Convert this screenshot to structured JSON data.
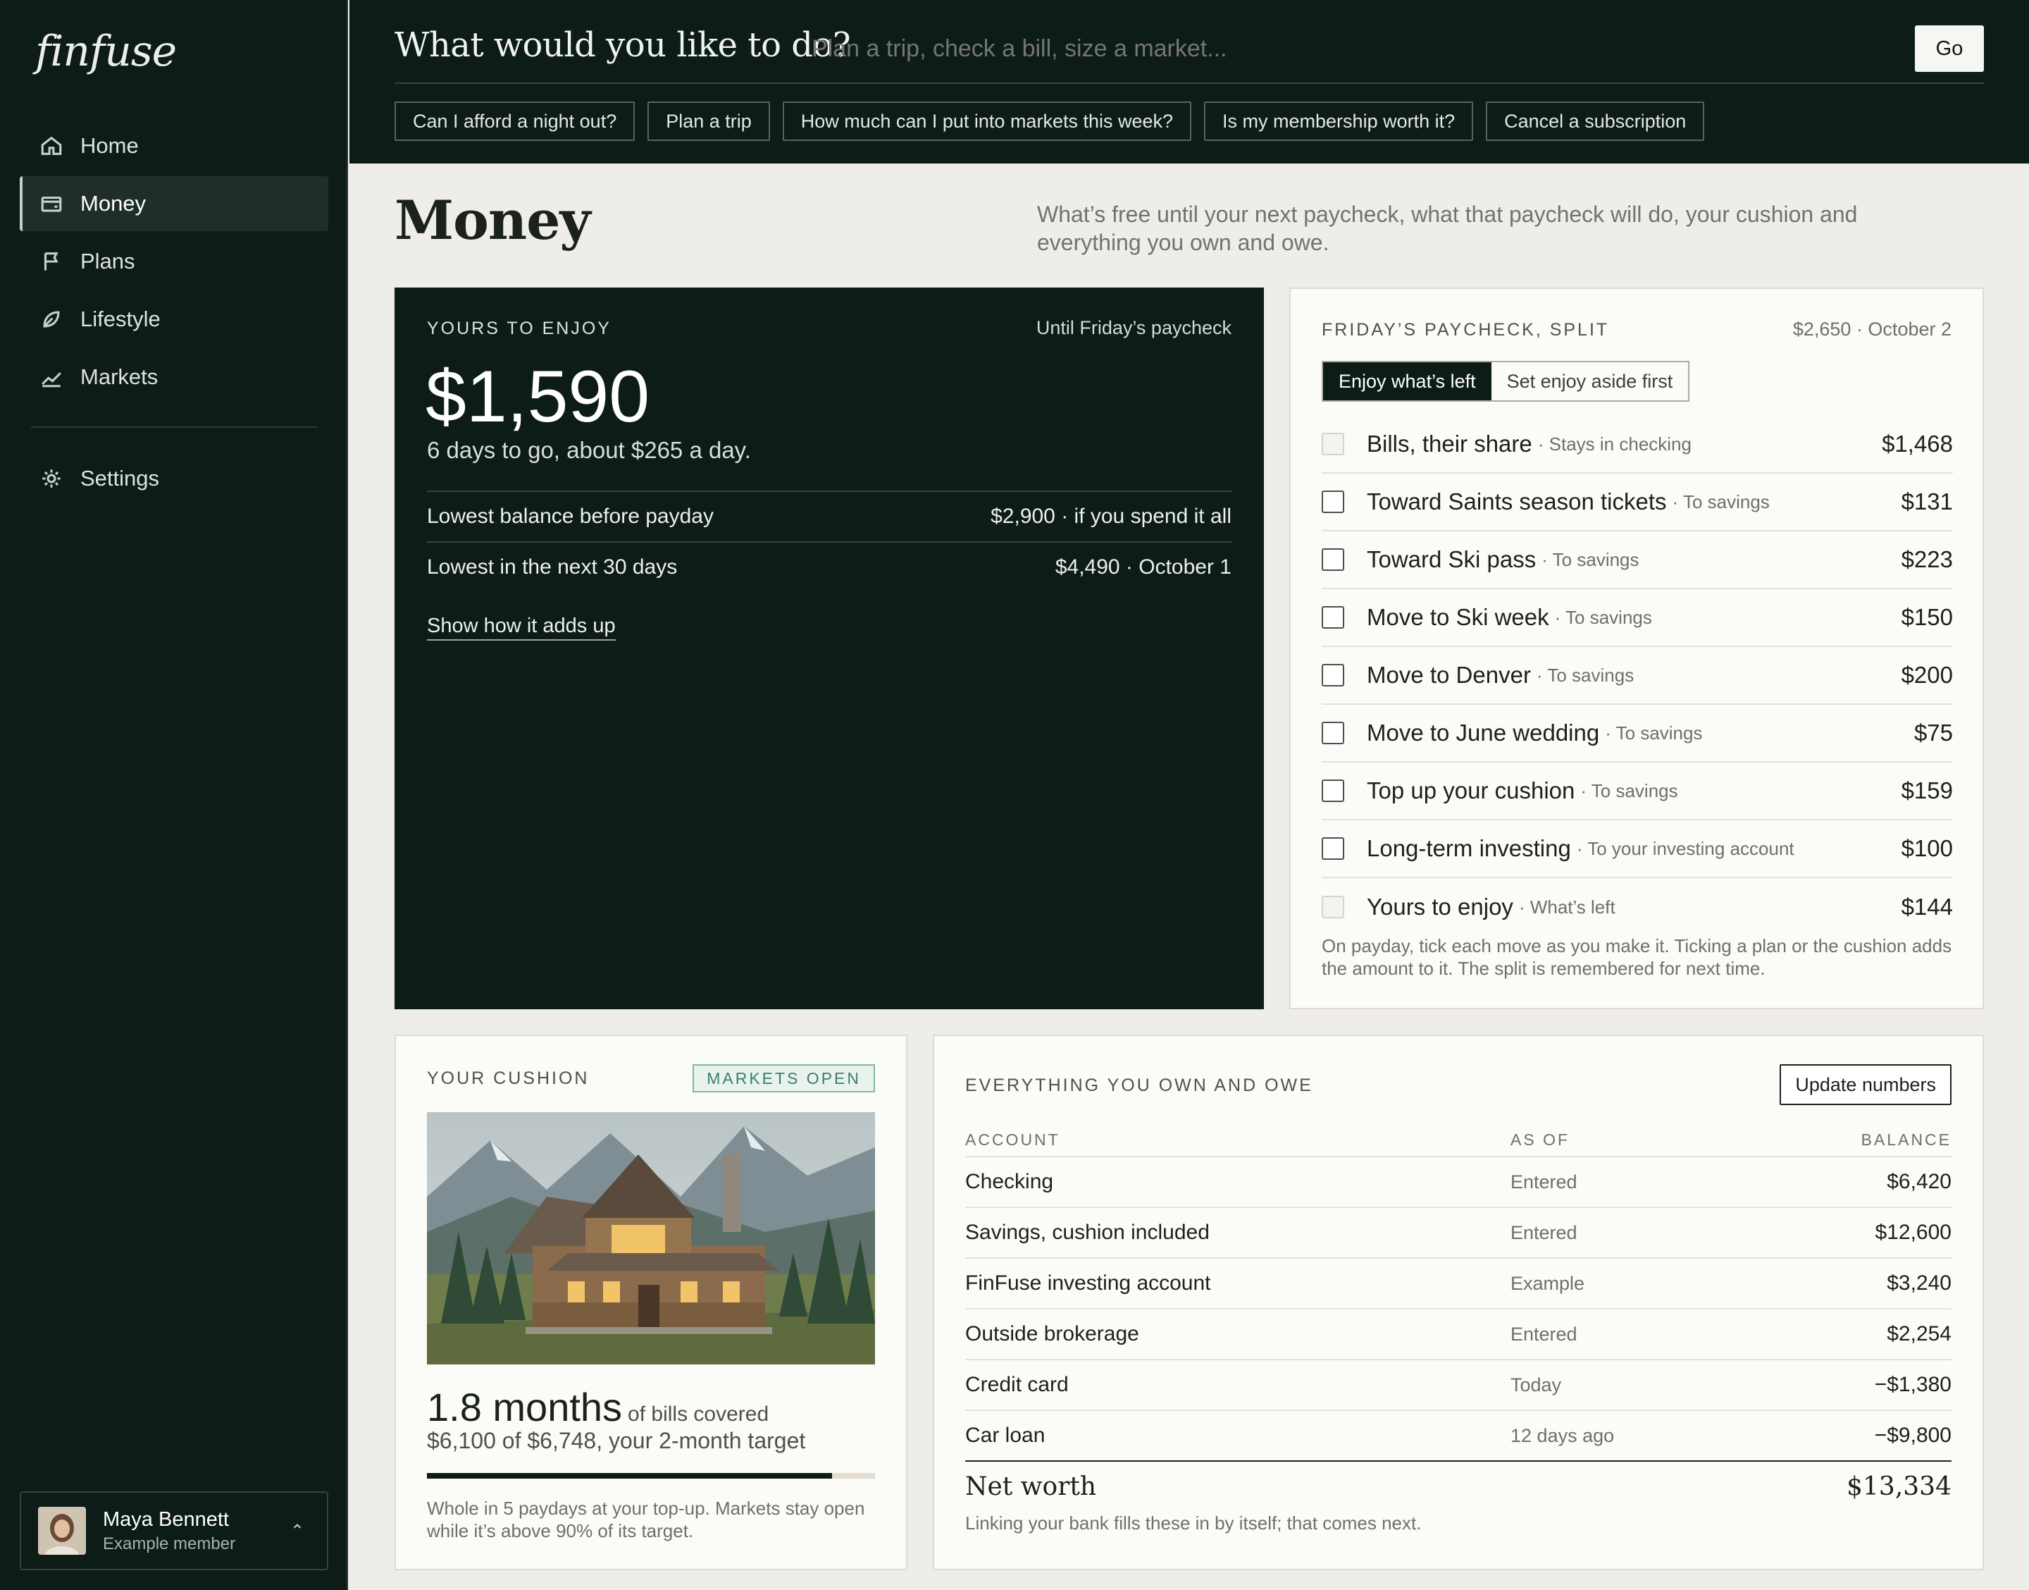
{
  "brand": {
    "logo": "finfuse"
  },
  "nav": {
    "items": [
      {
        "label": "Home",
        "icon": "home-icon"
      },
      {
        "label": "Money",
        "icon": "wallet-icon"
      },
      {
        "label": "Plans",
        "icon": "flag-icon"
      },
      {
        "label": "Lifestyle",
        "icon": "leaf-icon"
      },
      {
        "label": "Markets",
        "icon": "chart-line-icon"
      }
    ],
    "active": "Money",
    "settings": {
      "label": "Settings",
      "icon": "gear-icon"
    }
  },
  "user": {
    "name": "Maya Bennett",
    "subtitle": "Example member",
    "chevron": "⌃"
  },
  "prompt": {
    "title": "What would you like to do?",
    "placeholder": "Plan a trip, check a bill, size a market...",
    "go_label": "Go",
    "chips": [
      "Can I afford a night out?",
      "Plan a trip",
      "How much can I put into markets this week?",
      "Is my membership worth it?",
      "Cancel a subscription"
    ]
  },
  "page": {
    "title": "Money",
    "description": "What’s free until your next paycheck, what that paycheck will do, your cushion and everything you own and owe."
  },
  "enjoy": {
    "eyebrow": "Yours to enjoy",
    "until": "Until Friday’s paycheck",
    "amount": "$1,590",
    "days": "6 days to go, about $265 a day.",
    "rows": [
      {
        "label": "Lowest balance before payday",
        "value": "$2,900 · if you spend it all"
      },
      {
        "label": "Lowest in the next 30 days",
        "value": "$4,490 · October 1"
      }
    ],
    "link": "Show how it adds up"
  },
  "paycheck": {
    "eyebrow": "Friday’s paycheck, split",
    "meta": "$2,650 · October 2",
    "toggle": [
      "Enjoy what’s left",
      "Set enjoy aside first"
    ],
    "rows": [
      {
        "label": "Bills, their share",
        "sub": "· Stays in checking",
        "amount": "$1,468",
        "disabled": true
      },
      {
        "label": "Toward Saints season tickets",
        "sub": "· To savings",
        "amount": "$131"
      },
      {
        "label": "Toward Ski pass",
        "sub": "· To savings",
        "amount": "$223"
      },
      {
        "label": "Move to Ski week",
        "sub": "· To savings",
        "amount": "$150"
      },
      {
        "label": "Move to Denver",
        "sub": "· To savings",
        "amount": "$200"
      },
      {
        "label": "Move to June wedding",
        "sub": "· To savings",
        "amount": "$75"
      },
      {
        "label": "Top up your cushion",
        "sub": "· To savings",
        "amount": "$159"
      },
      {
        "label": "Long-term investing",
        "sub": "· To your investing account",
        "amount": "$100"
      },
      {
        "label": "Yours to enjoy",
        "sub": "· What’s left",
        "amount": "$144",
        "disabled": true
      }
    ],
    "note": "On payday, tick each move as you make it. Ticking a plan or the cushion adds the amount to it. The split is remembered for next time."
  },
  "cushion": {
    "eyebrow": "Your cushion",
    "badge": "MARKETS OPEN",
    "months": "1.8 months",
    "months_suffix": "of bills covered",
    "target_line": "$6,100 of $6,748, your 2-month target",
    "progress_fraction": 0.904,
    "note": "Whole in 5 paydays at your top-up. Markets stay open while it’s above 90% of its target."
  },
  "networth": {
    "eyebrow": "Everything you own and owe",
    "update_label": "Update numbers",
    "columns": [
      "ACCOUNT",
      "AS OF",
      "BALANCE"
    ],
    "rows": [
      {
        "account": "Checking",
        "asof": "Entered",
        "balance": "$6,420"
      },
      {
        "account": "Savings, cushion included",
        "asof": "Entered",
        "balance": "$12,600"
      },
      {
        "account": "FinFuse investing account",
        "asof": "Example",
        "balance": "$3,240"
      },
      {
        "account": "Outside brokerage",
        "asof": "Entered",
        "balance": "$2,254"
      },
      {
        "account": "Credit card",
        "asof": "Today",
        "balance": "−$1,380"
      },
      {
        "account": "Car loan",
        "asof": "12 days ago",
        "balance": "−$9,800"
      }
    ],
    "total_label": "Net worth",
    "total_value": "$13,334",
    "note": "Linking your bank fills these in by itself; that comes next."
  }
}
